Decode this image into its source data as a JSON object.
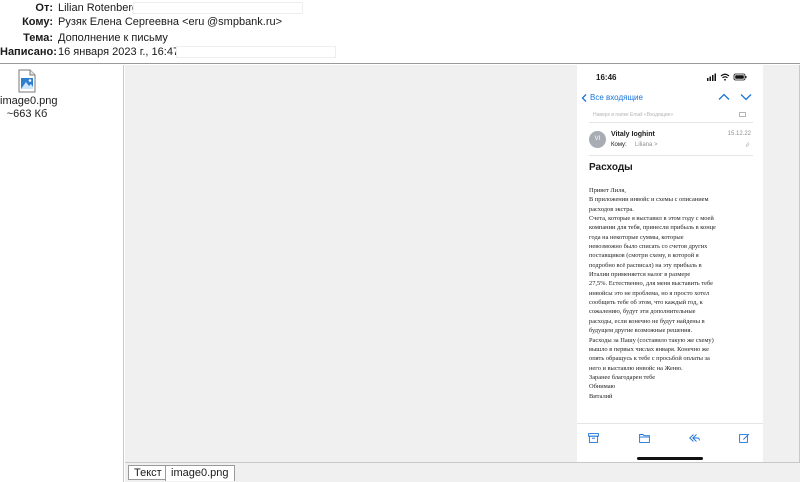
{
  "header": {
    "from_label": "От:",
    "from_value": "Lilian Rotenberg",
    "to_label": "Кому:",
    "to_value_start": "Рузяк Елена Сергеевна <eru",
    "to_value_end": "@smpbank.ru>",
    "subject_label": "Тема:",
    "subject_value": "Дополнение к письму",
    "date_label": "Написано:",
    "date_value": "16 января 2023 г., 16:47:10"
  },
  "attachment": {
    "name": "image0.png",
    "size": "~663 Кб"
  },
  "tabs": [
    {
      "label": "Текст"
    },
    {
      "label": "image0.png"
    }
  ],
  "phone": {
    "time": "16:46",
    "back_label": "Все входящие",
    "moved_notice": "Наверх в папке Email «Входящие»",
    "sender_initials": "VI",
    "sender_name": "Vitaly Ioghint",
    "date": "15.12.22",
    "to_label": "Кому:",
    "to_value": "Liliana >",
    "subject": "Расходы",
    "body_lines": [
      "Привет Лиля,",
      "В приложении инвойс и схемы с описанием",
      "расходов экстра.",
      "Счета, которые я выставил в этом году с моей",
      "компании для тебя, принесли прибыль в конце",
      "года на некоторые суммы, которые",
      "невозможно было списать со счетов других",
      "поставщиков (смотри схему, в которой я",
      "подробно всё расписал) на эту прибыль в",
      "Италии применяется налог в размере",
      "27,5%. Естественно, для меня выставить тебе",
      "инвойсы это не проблема, но я просто хотел",
      "сообщить тебе об этом, что каждый год, к",
      "сожалению, будут эти дополнительные",
      "расходы, если конечно не будут найдены в",
      "будущем другие возможные решения.",
      "Расходы за Пашу (составило такую же схему)",
      "вышло в первых числах января. Конечно же",
      "опять обращусь к тебе с просьбой оплаты за",
      "него и выставлю инвойс на Женю.",
      "Заранее благодарен тебе",
      "Обнимаю",
      "Виталий"
    ]
  },
  "colors": {
    "ios_blue": "#1a73d9",
    "pane_gray": "#f0f0f0"
  },
  "icons": [
    "image-file-icon",
    "ios-signal-icon",
    "ios-wifi-icon",
    "ios-battery-icon",
    "back-chevron-icon",
    "chevron-up-icon",
    "chevron-down-icon",
    "folder-icon",
    "paperclip-icon",
    "archive-icon",
    "move-folder-icon",
    "reply-icon",
    "compose-icon"
  ]
}
